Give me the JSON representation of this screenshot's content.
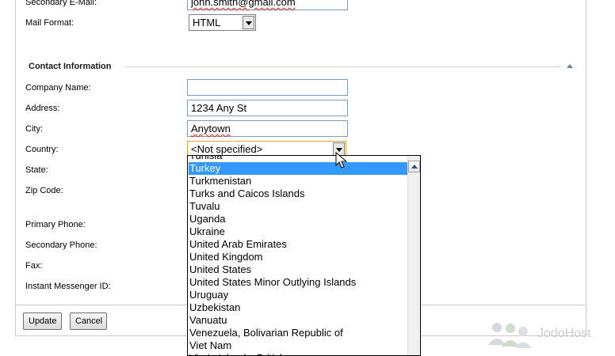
{
  "account": {
    "secondary_email_label": "Secondary E-Mail:",
    "secondary_email_value": "john.smith@gmail.com",
    "mail_format_label": "Mail Format:",
    "mail_format_value": "HTML"
  },
  "contact": {
    "section_title": "Contact Information",
    "company_label": "Company Name:",
    "company_value": "",
    "address_label": "Address:",
    "address_value": "1234 Any St",
    "city_label": "City:",
    "city_value": "Anytown",
    "country_label": "Country:",
    "country_value": "<Not specified>",
    "state_label": "State:",
    "zip_label": "Zip Code:",
    "primary_phone_label": "Primary Phone:",
    "secondary_phone_label": "Secondary Phone:",
    "fax_label": "Fax:",
    "im_label": "Instant Messenger ID:"
  },
  "country_dropdown": {
    "partial_top": "Tunisia",
    "options": [
      "Turkey",
      "Turkmenistan",
      "Turks and Caicos Islands",
      "Tuvalu",
      "Uganda",
      "Ukraine",
      "United Arab Emirates",
      "United Kingdom",
      "United States",
      "United States Minor Outlying Islands",
      "Uruguay",
      "Uzbekistan",
      "Vanuatu",
      "Venezuela, Bolivarian Republic of",
      "Viet Nam",
      "Virgin Islands, British"
    ],
    "selected": "Turkey",
    "selected_color": "#3399ff"
  },
  "buttons": {
    "update": "Update",
    "cancel": "Cancel"
  },
  "watermark": {
    "text": "JodoHost"
  }
}
